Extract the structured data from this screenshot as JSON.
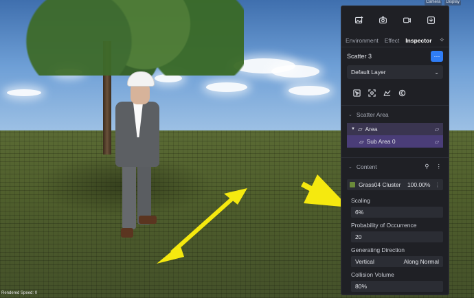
{
  "viewport": {
    "status_text": "Rendered Speed: 0",
    "toolbar": [
      "Camera",
      "Display"
    ]
  },
  "panel": {
    "top_icons": [
      "image-add-icon",
      "camera-icon",
      "video-icon",
      "export-icon"
    ],
    "tabs": [
      {
        "label": "Environment",
        "active": false
      },
      {
        "label": "Effect",
        "active": false
      },
      {
        "label": "Inspector",
        "active": true
      }
    ],
    "scatter_title": "Scatter 3",
    "scatter_button_glyph": "⋯",
    "layer_dropdown": "Default Layer",
    "tools": [
      "select-icon",
      "target-icon",
      "area-icon",
      "refresh-icon"
    ],
    "scatter_area": {
      "header": "Scatter Area",
      "items": [
        {
          "label": "Area",
          "sub": false
        },
        {
          "label": "Sub Area 0",
          "sub": true
        }
      ]
    },
    "content": {
      "header": "Content",
      "item_name": "Grass04 Cluster",
      "item_pct": "100.00%",
      "props": [
        {
          "label": "Scaling",
          "value": "6%"
        },
        {
          "label": "Probability of Occurrence",
          "value": "20"
        },
        {
          "label": "Generating Direction",
          "value_left": "Vertical",
          "value_right": "Along Normal"
        },
        {
          "label": "Collision Volume",
          "value": "80%"
        }
      ]
    }
  },
  "colors": {
    "accent": "#2f7df6",
    "arrow": "#f5e90f",
    "panel_bg": "#1f2025",
    "selected_row": "#4a3d78"
  }
}
